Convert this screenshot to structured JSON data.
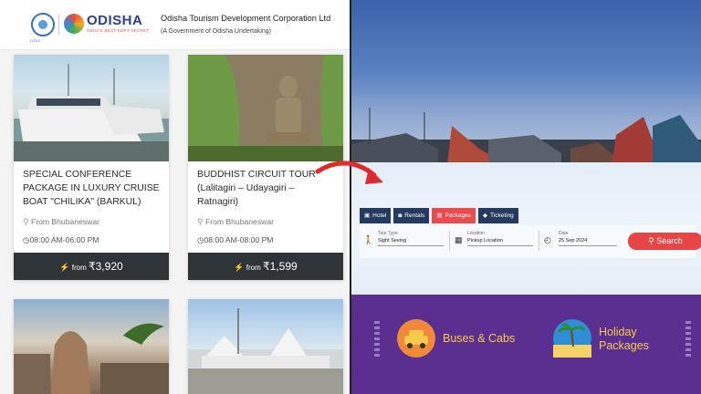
{
  "header": {
    "otdc_sub": "OTDC",
    "brand": "ODISHA",
    "brand_tagline": "INDIA'S BEST KEPT SECRET",
    "corp_title": "Odisha Tourism Development Corporation Ltd",
    "corp_sub": "(A Government of Odisha Undertaking)"
  },
  "cards": [
    {
      "title": "SPECIAL CONFERENCE PACKAGE IN LUXURY CRUISE BOAT \"CHILIKA\" (BARKUL)",
      "from": "From Bhubaneswar",
      "time": "08:00 AM-06:00 PM",
      "price_prefix": "from",
      "price": "₹3,920"
    },
    {
      "title": "BUDDHIST CIRCUIT TOUR (Lalitagiri – Udayagiri – Ratnagiri)",
      "from": "From Bhubaneswar",
      "time": "08:00 AM-08:00 PM",
      "price_prefix": "from",
      "price": "₹1,599"
    }
  ],
  "search": {
    "tabs": [
      {
        "label": "Hotel",
        "icon": "building-icon"
      },
      {
        "label": "Rentals",
        "icon": "car-icon"
      },
      {
        "label": "Packages",
        "icon": "briefcase-icon"
      },
      {
        "label": "Ticketing",
        "icon": "ticket-icon"
      }
    ],
    "active_tab": "Packages",
    "tour_type_label": "Tour Type",
    "tour_type_value": "Sight Seeing",
    "location_label": "Location",
    "location_value": "Pickup Location",
    "date_label": "Date",
    "date_value": "25 Sep 2024",
    "button_label": "Search"
  },
  "promo": {
    "buses_label_1": "Buses & Cabs",
    "holiday_label_1": "Holiday",
    "holiday_label_2": "Packages"
  },
  "colors": {
    "tab_bg": "#243a5e",
    "tab_active": "#e84c4c",
    "search_btn": "#e84646",
    "promo_bg": "#5b2f8f",
    "promo_text": "#f6c94a"
  }
}
